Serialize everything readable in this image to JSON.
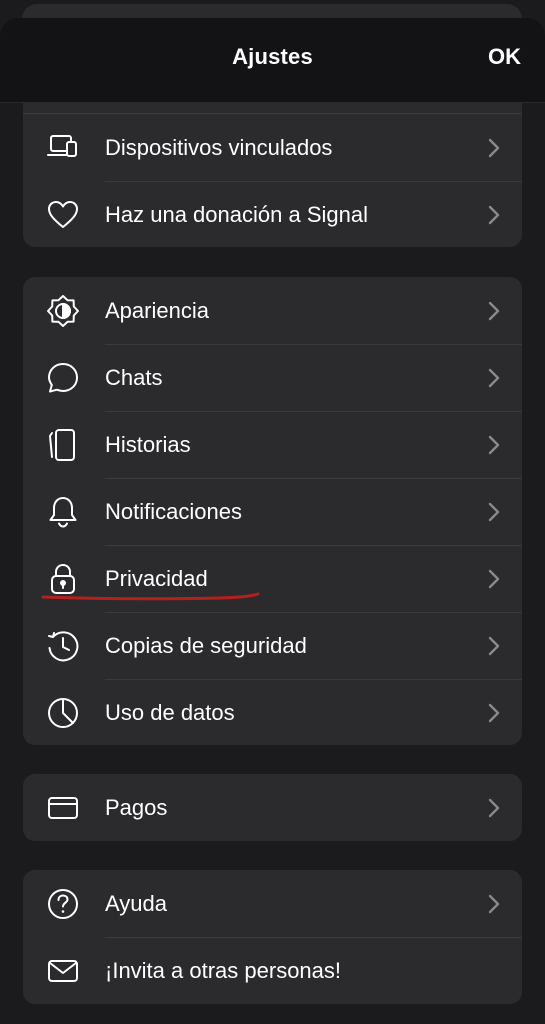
{
  "header": {
    "title": "Ajustes",
    "done_label": "OK"
  },
  "colors": {
    "annotation": "#b3201d",
    "chevron": "#8a8a8e",
    "card": "#2b2b2e"
  },
  "groups": [
    {
      "items": [
        {
          "label": "Dispositivos vinculados",
          "icon": "linked-devices-icon",
          "chevron": true
        },
        {
          "label": "Haz una donación a Signal",
          "icon": "heart-icon",
          "chevron": true
        }
      ]
    },
    {
      "items": [
        {
          "label": "Apariencia",
          "icon": "appearance-icon",
          "chevron": true
        },
        {
          "label": "Chats",
          "icon": "chat-bubble-icon",
          "chevron": true
        },
        {
          "label": "Historias",
          "icon": "stories-icon",
          "chevron": true
        },
        {
          "label": "Notificaciones",
          "icon": "bell-icon",
          "chevron": true
        },
        {
          "label": "Privacidad",
          "icon": "lock-icon",
          "chevron": true
        },
        {
          "label": "Copias de seguridad",
          "icon": "backup-clock-icon",
          "chevron": true
        },
        {
          "label": "Uso de datos",
          "icon": "pie-chart-icon",
          "chevron": true
        }
      ]
    },
    {
      "items": [
        {
          "label": "Pagos",
          "icon": "card-icon",
          "chevron": true
        }
      ]
    },
    {
      "items": [
        {
          "label": "Ayuda",
          "icon": "help-icon",
          "chevron": true
        },
        {
          "label": "¡Invita a otras personas!",
          "icon": "mail-icon",
          "chevron": false
        }
      ]
    }
  ]
}
